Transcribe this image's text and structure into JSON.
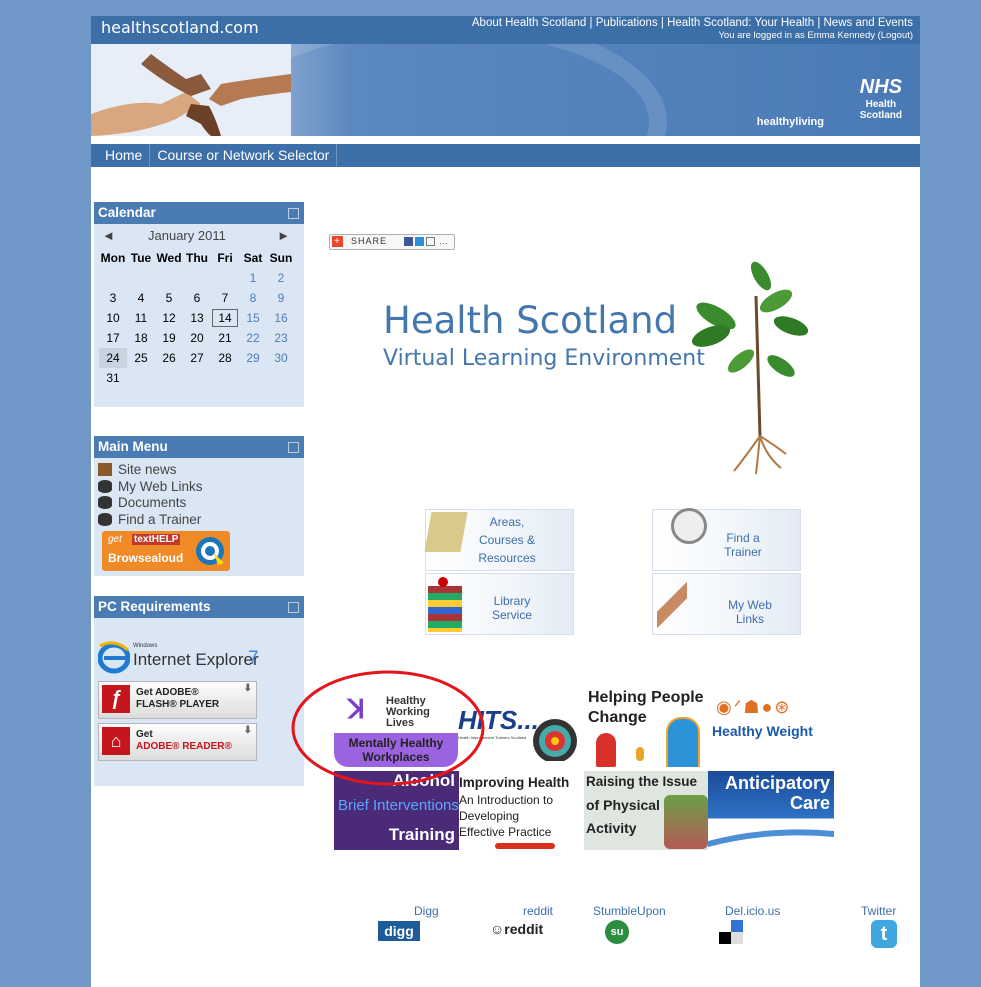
{
  "header": {
    "site_name": "healthscotland.com",
    "top_links": "About Health Scotland | Publications | Health Scotland: Your Health | News and Events",
    "logged_in": "You are logged in as Emma Kennedy (Logout)",
    "brand_logo": "NHS",
    "brand_sub1": "Health",
    "brand_sub2": "Scotland",
    "healthyliving": "healthyliving"
  },
  "nav": {
    "items": [
      "Home",
      "Course or Network Selector"
    ]
  },
  "calendar": {
    "title": "Calendar",
    "prev": "◄",
    "next": "►",
    "month": "January 2011",
    "weekdays": [
      "Mon",
      "Tue",
      "Wed",
      "Thu",
      "Fri",
      "Sat",
      "Sun"
    ],
    "weeks": [
      [
        "",
        "",
        "",
        "",
        "",
        "1",
        "2"
      ],
      [
        "3",
        "4",
        "5",
        "6",
        "7",
        "8",
        "9"
      ],
      [
        "10",
        "11",
        "12",
        "13",
        "14",
        "15",
        "16"
      ],
      [
        "17",
        "18",
        "19",
        "20",
        "21",
        "22",
        "23"
      ],
      [
        "24",
        "25",
        "26",
        "27",
        "28",
        "29",
        "30"
      ],
      [
        "31",
        "",
        "",
        "",
        "",
        "",
        ""
      ]
    ],
    "today": "14",
    "selected": "24"
  },
  "main_menu": {
    "title": "Main Menu",
    "items": [
      "Site news",
      "My Web Links",
      "Documents",
      "Find a Trainer"
    ],
    "browsealoud": {
      "get": "get",
      "brand": "textHELP",
      "name": "Browsealoud"
    }
  },
  "pc_requirements": {
    "title": "PC Requirements",
    "ie_small": "Windows",
    "ie_label": "Internet Explorer",
    "ie_version": "7",
    "flash_line1": "Get ADOBE®",
    "flash_line2": "FLASH® PLAYER",
    "reader_line1": "Get",
    "reader_line2": "ADOBE® READER®"
  },
  "share": {
    "label": "SHARE"
  },
  "hero": {
    "title": "Health Scotland",
    "subtitle": "Virtual Learning Environment"
  },
  "tiles": [
    {
      "line1": "Areas,",
      "line2": "Courses &",
      "line3": "Resources"
    },
    {
      "line1": "Find a",
      "line2": "Trainer"
    },
    {
      "line1": "Library",
      "line2": "Service"
    },
    {
      "line1": "My Web",
      "line2": "Links"
    }
  ],
  "courses": {
    "hwl_line1": "Healthy",
    "hwl_line2": "Working",
    "hwl_line3": "Lives",
    "hwl_band1": "Mentally Healthy",
    "hwl_band2": "Workplaces",
    "hits": "HITS...",
    "hits_sub": "Health Improvement Trainers Scotland",
    "helping1": "Helping People",
    "helping2": "Change",
    "weight": "Healthy Weight",
    "alcohol1": "Alcohol",
    "alcohol2": "Brief Interventions",
    "alcohol3": "Training",
    "improving1": "Improving Health",
    "improving2": "An Introduction to",
    "improving3": "Developing",
    "improving4": "Effective Practice",
    "raising1": "Raising the Issue",
    "raising2": "of Physical",
    "raising3": "Activity",
    "anticipatory1": "Anticipatory",
    "anticipatory2": "Care"
  },
  "social": [
    {
      "label": "Digg",
      "logo": "digg"
    },
    {
      "label": "reddit",
      "logo": "reddit"
    },
    {
      "label": "StumbleUpon",
      "logo": "su"
    },
    {
      "label": "Del.icio.us",
      "logo": ""
    },
    {
      "label": "Twitter",
      "logo": ""
    }
  ],
  "colors": {
    "accent": "#4a7bb3",
    "background": "#6f98c8",
    "highlight_circle": "#e3151a"
  }
}
